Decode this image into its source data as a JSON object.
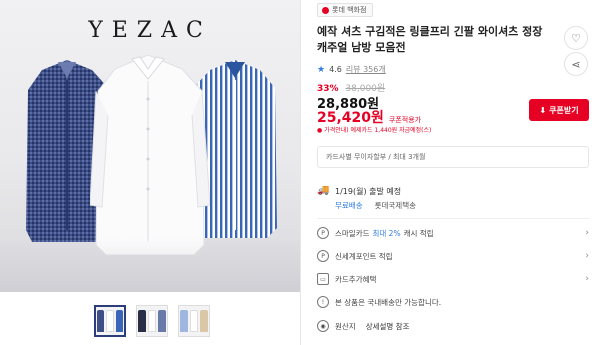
{
  "gallery": {
    "brand": "YEZAC",
    "thumbnails": [
      "thumb-1",
      "thumb-2",
      "thumb-3"
    ]
  },
  "product": {
    "seller": "롯데 백화점",
    "title": "예작 셔츠 구김적은 링클프리 긴팔 와이셔츠 정장 캐주얼 남방 모음전",
    "rating": "4.6",
    "reviews": "리뷰 356개",
    "discount": "33%",
    "original_price": "38,000원",
    "price": "28,880원",
    "coupon_price": "25,420원",
    "coupon_label": "쿠폰적용가",
    "coupon_button": "쿠폰받기",
    "card_note": "가격안내) 예제카드 1,440원 자금예정(스)",
    "card_info": "카드사별 무이자할부 / 최대 3개월",
    "shipping": {
      "date": "1/19(월) 출발 예정",
      "free": "무료배송",
      "courier": "롯데국제택송"
    },
    "benefits": [
      {
        "icon": "P",
        "prefix": "스마일카드",
        "highlight": "최대 2%",
        "suffix": "캐시 적립"
      },
      {
        "icon": "P",
        "prefix": "신세계포인트 적립",
        "highlight": "",
        "suffix": ""
      },
      {
        "icon": "▭",
        "prefix": "카드추가혜택",
        "highlight": "",
        "suffix": ""
      },
      {
        "icon": "!",
        "prefix": "본 상품은 국내배송만 가능합니다.",
        "highlight": "",
        "suffix": ""
      }
    ],
    "origin_label": "원산지",
    "origin_detail": "상세설명 참조"
  },
  "colors": {
    "accent_red": "#e60023",
    "accent_blue": "#2f7de1"
  }
}
